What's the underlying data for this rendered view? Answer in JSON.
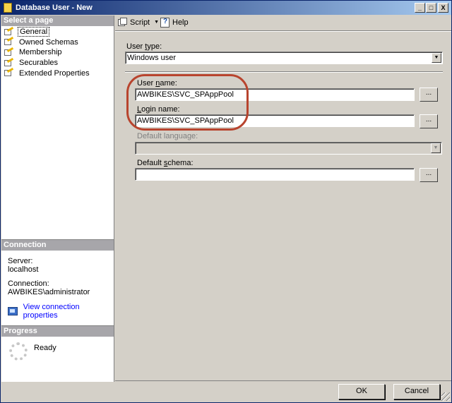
{
  "window": {
    "title": "Database User - New",
    "minimize_glyph": "_",
    "maximize_glyph": "□",
    "close_glyph": "X"
  },
  "left_pane": {
    "select_page_header": "Select a page",
    "pages": [
      {
        "label": "General",
        "icon": "page-wand-icon",
        "selected": true
      },
      {
        "label": "Owned Schemas",
        "icon": "page-wand-icon",
        "selected": false
      },
      {
        "label": "Membership",
        "icon": "page-wand-icon",
        "selected": false
      },
      {
        "label": "Securables",
        "icon": "page-wand-icon",
        "selected": false
      },
      {
        "label": "Extended Properties",
        "icon": "page-wand-icon",
        "selected": false
      }
    ],
    "connection": {
      "header": "Connection",
      "server_label": "Server:",
      "server_value": "localhost",
      "connection_label": "Connection:",
      "connection_value": "AWBIKES\\administrator",
      "view_link": "View connection properties"
    },
    "progress": {
      "header": "Progress",
      "status": "Ready"
    }
  },
  "toolbar": {
    "script_label": "Script",
    "script_caret": "▼",
    "help_label": "Help"
  },
  "form": {
    "user_type": {
      "label_pre": "User ",
      "label_ul": "t",
      "label_post": "ype:",
      "value": "Windows user",
      "arrow": "▼"
    },
    "user_name": {
      "label_pre": "User ",
      "label_ul": "n",
      "label_post": "ame:",
      "value": "AWBIKES\\SVC_SPAppPool",
      "browse": "..."
    },
    "login_name": {
      "label_ul": "L",
      "label_post": "ogin name:",
      "value": "AWBIKES\\SVC_SPAppPool",
      "browse": "..."
    },
    "default_language": {
      "label": "Default language:",
      "value": "",
      "arrow": "▼"
    },
    "default_schema": {
      "label_pre": "Default ",
      "label_ul": "s",
      "label_post": "chema:",
      "value": "",
      "browse": "..."
    }
  },
  "buttons": {
    "ok": "OK",
    "cancel": "Cancel"
  },
  "colors": {
    "title_start": "#0a246a",
    "title_end": "#a6caf0",
    "dialog_bg": "#d4d0c8",
    "section_header": "#a7a6aa",
    "highlight_ring": "#b8442e",
    "link": "#0000ff"
  }
}
